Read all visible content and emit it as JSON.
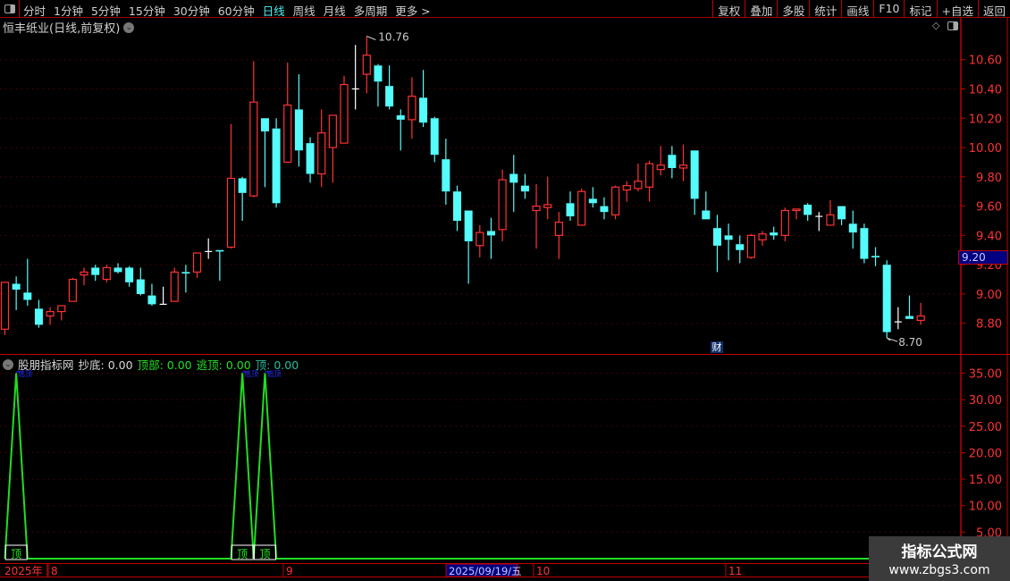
{
  "toolbar": {
    "periods": [
      "分时",
      "1分钟",
      "5分钟",
      "15分钟",
      "30分钟",
      "60分钟",
      "日线",
      "周线",
      "月线",
      "多周期",
      "更多 >"
    ],
    "active_period": "日线",
    "buttons": [
      "复权",
      "叠加",
      "多股",
      "统计",
      "画线",
      "F10",
      "标记",
      "+自选",
      "返回"
    ]
  },
  "chart_title": "恒丰纸业(日线,前复权)",
  "colors": {
    "up": "#ff3232",
    "down": "#54fcfc",
    "doji": "#ffffff",
    "grid": "#7a0000",
    "axis": "#c00000",
    "indicator_line": "#22dd22"
  },
  "price_axis": {
    "ticks": [
      "10.60",
      "10.40",
      "10.20",
      "10.00",
      "9.80",
      "9.60",
      "9.40",
      "9.20",
      "9.00",
      "8.80"
    ],
    "current_price": "9.20"
  },
  "annotations": {
    "high": "10.76",
    "low": "8.70",
    "finance_marker": "财"
  },
  "candles": [
    [
      8.76,
      9.08,
      8.72,
      9.08
    ],
    [
      9.07,
      9.12,
      8.89,
      9.03
    ],
    [
      9.01,
      9.24,
      8.92,
      8.96
    ],
    [
      8.9,
      8.96,
      8.77,
      8.79
    ],
    [
      8.85,
      8.91,
      8.79,
      8.88
    ],
    [
      8.88,
      8.92,
      8.82,
      8.92
    ],
    [
      8.95,
      9.11,
      8.95,
      9.1
    ],
    [
      9.13,
      9.18,
      9.06,
      9.15
    ],
    [
      9.18,
      9.2,
      9.09,
      9.13
    ],
    [
      9.1,
      9.2,
      9.08,
      9.18
    ],
    [
      9.18,
      9.21,
      9.14,
      9.15
    ],
    [
      9.18,
      9.19,
      9.05,
      9.08
    ],
    [
      9.1,
      9.18,
      8.99,
      9.0
    ],
    [
      8.99,
      9.07,
      8.92,
      8.93
    ],
    [
      8.93,
      9.05,
      8.93,
      8.93
    ],
    [
      8.95,
      9.18,
      8.95,
      9.15
    ],
    [
      9.15,
      9.2,
      9.01,
      9.14
    ],
    [
      9.15,
      9.28,
      9.11,
      9.28
    ],
    [
      9.29,
      9.38,
      9.24,
      9.29
    ],
    [
      9.3,
      9.3,
      9.09,
      9.29
    ],
    [
      9.32,
      10.16,
      9.31,
      9.79
    ],
    [
      9.79,
      9.8,
      9.5,
      9.69
    ],
    [
      9.67,
      10.59,
      9.66,
      10.31
    ],
    [
      10.2,
      10.2,
      9.73,
      10.11
    ],
    [
      10.13,
      10.2,
      9.59,
      9.62
    ],
    [
      9.9,
      10.58,
      9.9,
      10.29
    ],
    [
      10.26,
      10.5,
      9.87,
      9.98
    ],
    [
      10.03,
      10.07,
      9.76,
      9.82
    ],
    [
      9.82,
      10.26,
      9.73,
      10.1
    ],
    [
      10.0,
      10.22,
      9.76,
      10.22
    ],
    [
      10.03,
      10.49,
      10.03,
      10.43
    ],
    [
      10.4,
      10.7,
      10.26,
      10.4
    ],
    [
      10.5,
      10.76,
      10.37,
      10.63
    ],
    [
      10.56,
      10.57,
      10.28,
      10.45
    ],
    [
      10.42,
      10.56,
      10.26,
      10.28
    ],
    [
      10.22,
      10.26,
      9.98,
      10.19
    ],
    [
      10.19,
      10.48,
      10.06,
      10.35
    ],
    [
      10.34,
      10.53,
      10.14,
      10.17
    ],
    [
      10.2,
      10.21,
      9.9,
      9.95
    ],
    [
      9.92,
      10.06,
      9.61,
      9.7
    ],
    [
      9.7,
      9.74,
      9.43,
      9.5
    ],
    [
      9.57,
      9.57,
      9.07,
      9.36
    ],
    [
      9.33,
      9.47,
      9.25,
      9.42
    ],
    [
      9.43,
      9.52,
      9.24,
      9.4
    ],
    [
      9.44,
      9.85,
      9.36,
      9.78
    ],
    [
      9.82,
      9.95,
      9.56,
      9.76
    ],
    [
      9.74,
      9.82,
      9.65,
      9.7
    ],
    [
      9.57,
      9.75,
      9.31,
      9.6
    ],
    [
      9.59,
      9.8,
      9.51,
      9.61
    ],
    [
      9.4,
      9.56,
      9.24,
      9.49
    ],
    [
      9.62,
      9.7,
      9.5,
      9.53
    ],
    [
      9.47,
      9.72,
      9.47,
      9.7
    ],
    [
      9.65,
      9.73,
      9.59,
      9.62
    ],
    [
      9.6,
      9.66,
      9.51,
      9.56
    ],
    [
      9.54,
      9.74,
      9.51,
      9.73
    ],
    [
      9.71,
      9.77,
      9.63,
      9.74
    ],
    [
      9.72,
      9.89,
      9.7,
      9.77
    ],
    [
      9.73,
      9.91,
      9.63,
      9.89
    ],
    [
      9.85,
      10.01,
      9.81,
      9.88
    ],
    [
      9.95,
      10.01,
      9.79,
      9.86
    ],
    [
      9.86,
      10.02,
      9.77,
      9.88
    ],
    [
      9.98,
      9.98,
      9.54,
      9.65
    ],
    [
      9.57,
      9.7,
      9.51,
      9.51
    ],
    [
      9.45,
      9.54,
      9.15,
      9.33
    ],
    [
      9.4,
      9.48,
      9.23,
      9.37
    ],
    [
      9.34,
      9.4,
      9.21,
      9.3
    ],
    [
      9.25,
      9.41,
      9.24,
      9.4
    ],
    [
      9.37,
      9.43,
      9.33,
      9.41
    ],
    [
      9.42,
      9.46,
      9.37,
      9.4
    ],
    [
      9.4,
      9.59,
      9.36,
      9.57
    ],
    [
      9.57,
      9.58,
      9.51,
      9.58
    ],
    [
      9.61,
      9.62,
      9.5,
      9.54
    ],
    [
      9.53,
      9.56,
      9.43,
      9.53
    ],
    [
      9.47,
      9.64,
      9.47,
      9.54
    ],
    [
      9.6,
      9.6,
      9.47,
      9.51
    ],
    [
      9.48,
      9.57,
      9.31,
      9.42
    ],
    [
      9.45,
      9.48,
      9.21,
      9.24
    ],
    [
      9.26,
      9.32,
      9.19,
      9.25
    ],
    [
      9.2,
      9.23,
      8.7,
      8.74
    ],
    [
      8.81,
      8.91,
      8.76,
      8.81
    ],
    [
      8.85,
      8.99,
      8.83,
      8.83
    ],
    [
      8.82,
      8.94,
      8.79,
      8.85
    ]
  ],
  "indicator": {
    "name": "股朋指标网",
    "fields": [
      {
        "label": "抄底:",
        "value": "0.00"
      },
      {
        "label": "顶部:",
        "value": "0.00"
      },
      {
        "label": "逃顶:",
        "value": "0.00"
      },
      {
        "label": "顶:",
        "value": "0.00"
      }
    ],
    "axis_ticks": [
      "35.00",
      "30.00",
      "25.00",
      "20.00",
      "15.00",
      "10.00",
      "5.00"
    ],
    "signal_indices": [
      1,
      21,
      23
    ],
    "signal_value": 35,
    "signal_label": "顶",
    "top_label": "逃顶"
  },
  "time_axis": {
    "year": "2025年",
    "months": [
      "8",
      "9",
      "10",
      "11"
    ],
    "cursor_date": "2025/09/19/五"
  },
  "watermark": {
    "title": "指标公式网",
    "url": "www.zbgs3.com"
  }
}
